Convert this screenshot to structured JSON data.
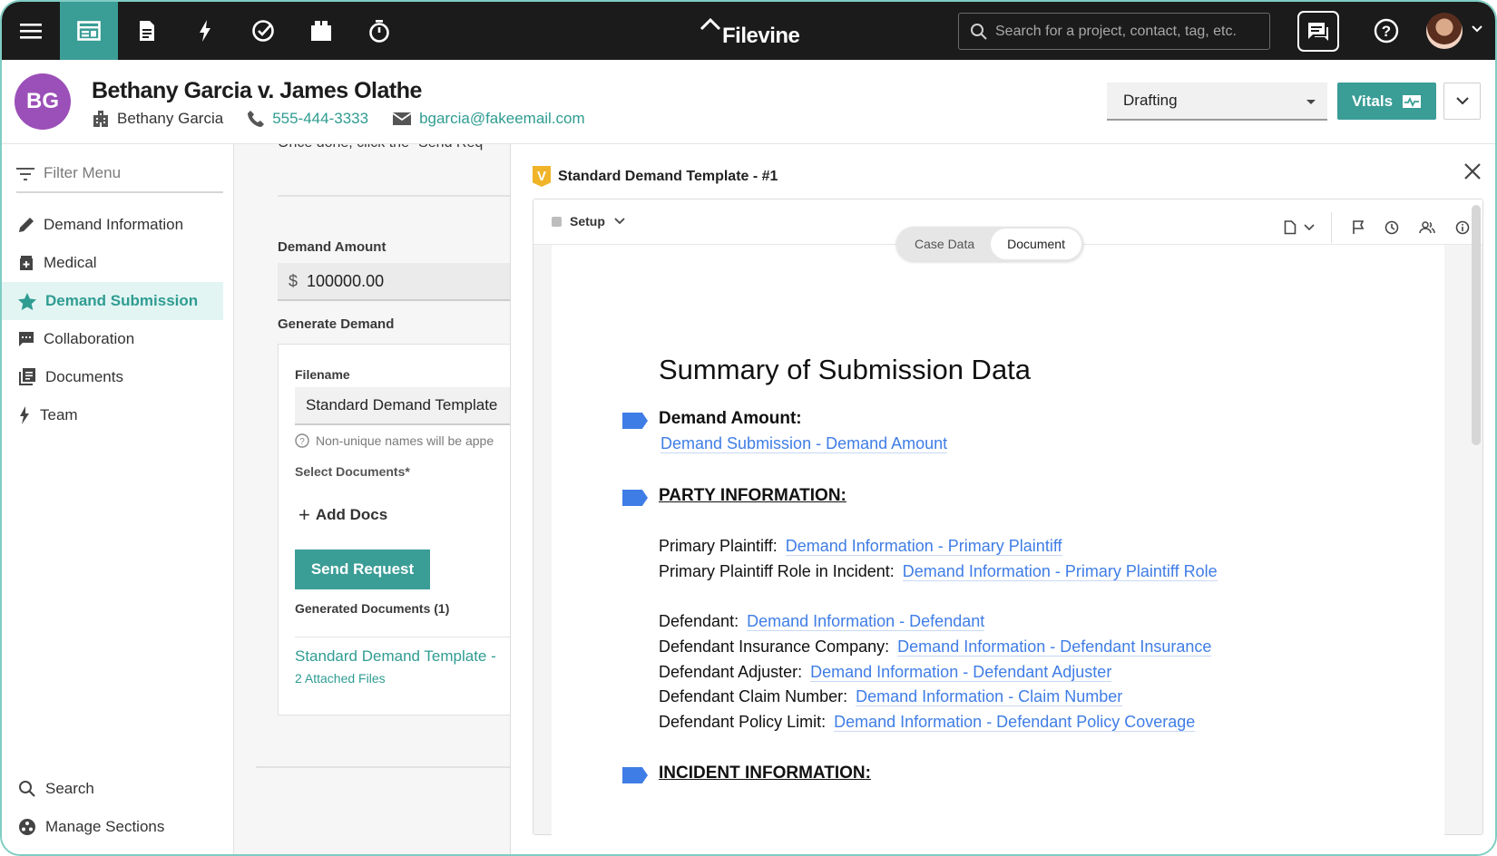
{
  "topbar": {
    "logo": "Filevine",
    "search_placeholder": "Search for a project, contact, tag, etc."
  },
  "header": {
    "avatar_initials": "BG",
    "title": "Bethany Garcia v. James Olathe",
    "client": "Bethany Garcia",
    "phone": "555-444-3333",
    "email": "bgarcia@fakeemail.com",
    "phase": "Drafting",
    "vitals_label": "Vitals"
  },
  "sidebar": {
    "filter_placeholder": "Filter Menu",
    "items": [
      {
        "label": "Demand Information",
        "icon": "pencil-icon"
      },
      {
        "label": "Medical",
        "icon": "medical-icon"
      },
      {
        "label": "Demand Submission",
        "icon": "star-icon",
        "active": true
      },
      {
        "label": "Collaboration",
        "icon": "comment-icon"
      },
      {
        "label": "Documents",
        "icon": "documents-icon"
      },
      {
        "label": "Team",
        "icon": "lightning-icon"
      }
    ],
    "bottom": [
      {
        "label": "Search",
        "icon": "search-icon"
      },
      {
        "label": "Manage Sections",
        "icon": "manage-sections-icon"
      }
    ]
  },
  "form": {
    "cut_text": "Once done, click the \"Send Req",
    "demand_amount_label": "Demand Amount",
    "currency_symbol": "$",
    "demand_amount_value": "100000.00",
    "generate_demand_label": "Generate Demand",
    "filename_label": "Filename",
    "filename_value": "Standard Demand Template",
    "filename_hint": "Non-unique names will be appe",
    "select_documents_label": "Select Documents*",
    "add_docs_label": "Add Docs",
    "send_request_label": "Send Request",
    "generated_documents_label": "Generated Documents (1)",
    "generated_doc_link": "Standard Demand Template -",
    "generated_doc_files": "2 Attached Files"
  },
  "panel": {
    "logo_letter": "V",
    "title": "Standard Demand Template - #1",
    "setup_label": "Setup",
    "tabs": [
      "Case Data",
      "Document"
    ],
    "active_tab": "Document",
    "document": {
      "heading": "Summary of Submission Data",
      "demand_amount_label": "Demand Amount:",
      "demand_amount_field": "Demand Submission - Demand Amount",
      "party_heading": "PARTY INFORMATION:",
      "party_rows": [
        {
          "label": "Primary Plaintiff:",
          "field": "Demand Information - Primary Plaintiff"
        },
        {
          "label": "Primary Plaintiff Role in Incident:",
          "field": "Demand Information - Primary Plaintiff Role"
        },
        {
          "label": "Defendant:",
          "field": "Demand Information - Defendant"
        },
        {
          "label": "Defendant Insurance Company:",
          "field": "Demand Information - Defendant Insurance"
        },
        {
          "label": "Defendant Adjuster:",
          "field": "Demand Information - Defendant Adjuster"
        },
        {
          "label": "Defendant Claim Number:",
          "field": "Demand Information - Claim Number"
        },
        {
          "label": "Defendant Policy Limit:",
          "field": "Demand Information - Defendant Policy Coverage"
        }
      ],
      "incident_heading": "INCIDENT INFORMATION:"
    }
  },
  "colors": {
    "brand_teal": "#3a9d96",
    "link_teal": "#2f9c92",
    "merge_blue": "#3f7de6",
    "avatar_purple": "#9b4fb8",
    "topbar": "#1b1b1b"
  }
}
